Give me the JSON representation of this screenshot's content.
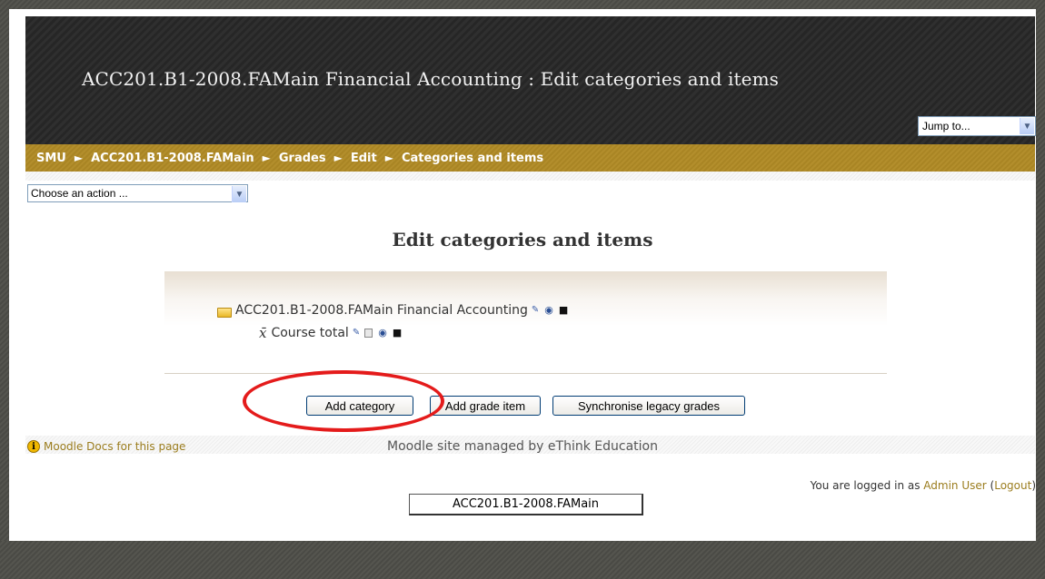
{
  "header": {
    "title": "ACC201.B1-2008.FAMain Financial Accounting : Edit categories and items",
    "jump_to": "Jump to..."
  },
  "navbar": {
    "crumbs": [
      "SMU",
      "ACC201.B1-2008.FAMain",
      "Grades",
      "Edit",
      "Categories and items"
    ],
    "separator": "►"
  },
  "action_select": {
    "value": "Choose an action ..."
  },
  "main": {
    "heading": "Edit categories and items",
    "tree": {
      "category_name": "ACC201.B1-2008.FAMain Financial Accounting",
      "total_symbol": "x̄",
      "total_label": "Course total"
    },
    "buttons": {
      "add_category": "Add category",
      "add_grade_item": "Add grade item",
      "synchronise": "Synchronise legacy grades"
    }
  },
  "footer": {
    "docs_link": "Moodle Docs for this page",
    "managed_by": "Moodle site managed by eThink Education",
    "login_prefix": "You are logged in as ",
    "user_name": "Admin User",
    "logout_open": " (",
    "logout_label": "Logout",
    "logout_close": ")",
    "course_button": "ACC201.B1-2008.FAMain"
  },
  "colors": {
    "navbar": "#b38e2c",
    "header": "#2b2b2b",
    "link": "#9b7d1e",
    "highlight": "#e41b1b"
  },
  "icons": {
    "info": "i",
    "dropdown": "▾",
    "edit": "✎",
    "eye": "◉",
    "lock": "🔒"
  }
}
